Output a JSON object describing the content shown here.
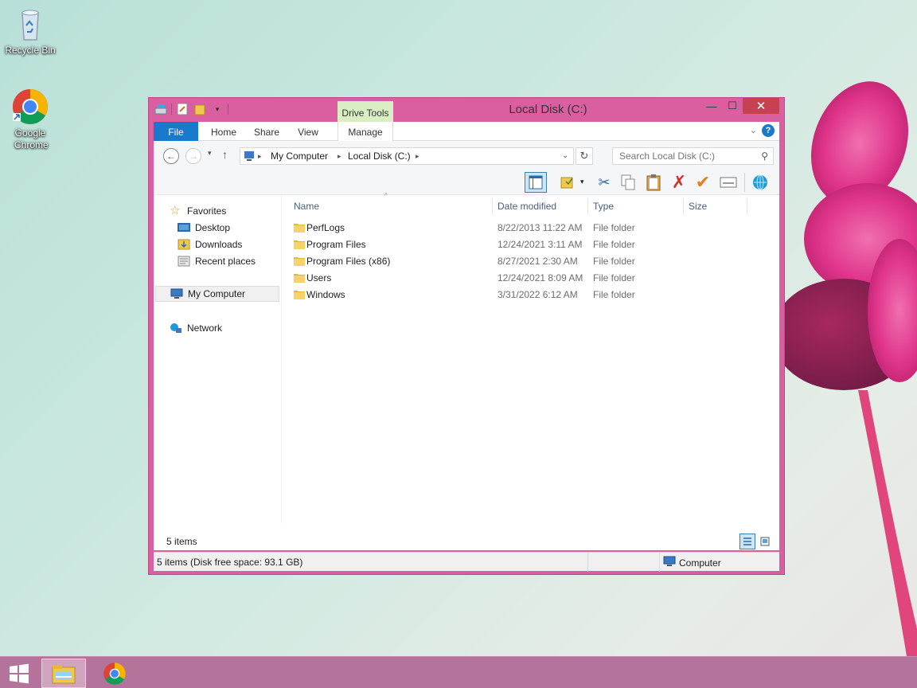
{
  "desktop": {
    "icons": [
      {
        "label": "Recycle Bin",
        "icon": "recycle-bin-icon"
      },
      {
        "label": "Google Chrome",
        "icon": "chrome-icon"
      }
    ]
  },
  "window": {
    "title": "Local Disk (C:)",
    "contextual_tab": "Drive Tools",
    "controls": {
      "minimize": "—",
      "maximize": "☐",
      "close": "✕"
    },
    "ribbon_tabs": [
      "File",
      "Home",
      "Share",
      "View",
      "Manage"
    ],
    "address": {
      "segments": [
        "My Computer",
        "Local Disk (C:)"
      ],
      "search_placeholder": "Search Local Disk (C:)"
    },
    "nav_pane": {
      "favorites_label": "Favorites",
      "favorites": [
        "Desktop",
        "Downloads",
        "Recent places"
      ],
      "computer": "My Computer",
      "network": "Network"
    },
    "columns": [
      "Name",
      "Date modified",
      "Type",
      "Size"
    ],
    "files": [
      {
        "name": "PerfLogs",
        "date": "8/22/2013 11:22 AM",
        "type": "File folder",
        "size": ""
      },
      {
        "name": "Program Files",
        "date": "12/24/2021 3:11 AM",
        "type": "File folder",
        "size": ""
      },
      {
        "name": "Program Files (x86)",
        "date": "8/27/2021 2:30 AM",
        "type": "File folder",
        "size": ""
      },
      {
        "name": "Users",
        "date": "12/24/2021 8:09 AM",
        "type": "File folder",
        "size": ""
      },
      {
        "name": "Windows",
        "date": "3/31/2022 6:12 AM",
        "type": "File folder",
        "size": ""
      }
    ],
    "item_count": "5 items",
    "status_left": "5 items (Disk free space: 93.1 GB)",
    "status_right": "Computer"
  },
  "colors": {
    "window_frame": "#d95fa0",
    "file_tab": "#1979ca",
    "drive_tools_tab": "#d9efc3",
    "close_button": "#c74250",
    "taskbar": "#b4739b"
  }
}
